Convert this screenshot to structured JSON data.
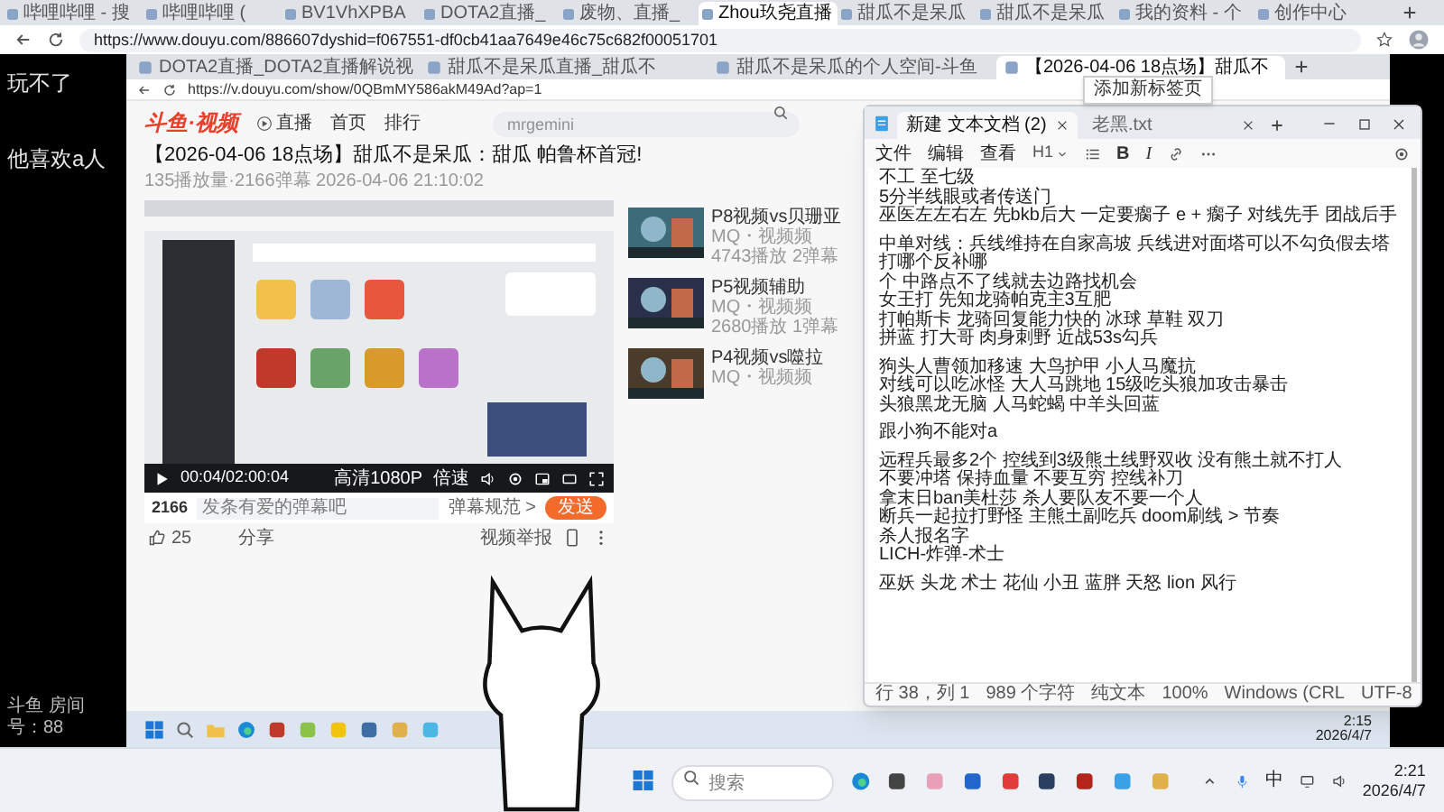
{
  "browser": {
    "tabs": [
      {
        "label": "哔哩哔哩 - 搜",
        "selected": false
      },
      {
        "label": "哔哩哔哩 (",
        "selected": false
      },
      {
        "label": "BV1VhXPBA",
        "selected": false
      },
      {
        "label": "DOTA2直播_",
        "selected": false
      },
      {
        "label": "废物、直播_",
        "selected": false
      },
      {
        "label": "Zhou玖尧直播",
        "selected": true
      },
      {
        "label": "甜瓜不是呆瓜",
        "selected": false
      },
      {
        "label": "甜瓜不是呆瓜",
        "selected": false
      },
      {
        "label": "我的资料 - 个",
        "selected": false
      },
      {
        "label": "创作中心",
        "selected": false
      }
    ],
    "url": "https://www.douyu.com/886607dyshid=f067551-df0cb41aa7649e46c75c682f00051701"
  },
  "stream": {
    "comments": [
      "玩不了",
      "他喜欢a人"
    ],
    "room_label": "斗鱼 房间号：88"
  },
  "inner_browser": {
    "tabs": [
      {
        "label": "DOTA2直播_DOTA2直播解说视",
        "selected": false
      },
      {
        "label": "甜瓜不是呆瓜直播_甜瓜不",
        "selected": false
      },
      {
        "label": "甜瓜不是呆瓜的个人空间-斗鱼",
        "selected": false
      },
      {
        "label": "【2026-04-06 18点场】甜瓜不",
        "selected": true
      }
    ],
    "url": "https://v.douyu.com/show/0QBmMY586akM49Ad?ap=1"
  },
  "site": {
    "logo": "斗鱼·视频",
    "live_link": "直播",
    "nav": [
      "首页",
      "排行"
    ],
    "search": {
      "placeholder": "mrgemini"
    }
  },
  "video": {
    "title": "【2026-04-06 18点场】甜瓜不是呆瓜：甜瓜 帕鲁杯首冠!",
    "meta": "135播放量·2166弹幕  2026-04-06 21:10:02",
    "time": "00:04/02:00:04",
    "quality": "高清1080P",
    "speed": "倍速"
  },
  "danmaku_bar": {
    "count": "2166",
    "placeholder": "发条有爱的弹幕吧",
    "rules": "弹幕规范 >",
    "send": "发送"
  },
  "actions": {
    "likes": "25",
    "share": "分享",
    "report": "视频举报"
  },
  "related": [
    {
      "title": "P8视频vs贝珊亚",
      "channel": "MQ・视频频",
      "stats": "4743播放 2弹幕"
    },
    {
      "title": "P5视频辅助",
      "channel": "MQ・视频频",
      "stats": "2680播放 1弹幕"
    },
    {
      "title": "P4视频vs噬拉",
      "channel": "MQ・视频频"
    }
  ],
  "notepad": {
    "tooltip": "添加新标签页",
    "tabs": [
      {
        "label": "新建 文本文档 (2)",
        "selected": true
      },
      {
        "label": "老黑.txt",
        "selected": false
      }
    ],
    "menu": [
      "文件",
      "编辑",
      "查看"
    ],
    "heading_style": "H1",
    "format_buttons": [
      "B",
      "I"
    ],
    "paragraphs": [
      [
        "不工 至七级",
        "5分半线眼或者传送门",
        "巫医左左右左 先bkb后大 一定要瘸子 e + 瘸子 对线先手 团战后手"
      ],
      [
        "中单对线：兵线维持在自家高坡 兵线进对面塔可以不勾负假去塔打哪个反补哪",
        "个 中路点不了线就去边路找机会",
        "女王打 先知龙骑帕克主3互肥",
        "打帕斯卡 龙骑回复能力快的 冰球 草鞋 双刀",
        "拼蓝 打大哥 肉身刺野 近战53s勾兵"
      ],
      [
        "狗头人曹领加移速 大鸟护甲 小人马魔抗",
        "对线可以吃冰怪 大人马跳地 15级吃头狼加攻击暴击",
        "头狼黑龙无脑 人马蛇蝎 中羊头回蓝"
      ],
      [
        "跟小狗不能对a"
      ],
      [
        "远程兵最多2个 控线到3级熊土线野双收 没有熊土就不打人",
        "不要冲塔 保持血量 不要互穷 控线补刀",
        "拿末日ban美杜莎 杀人要队友不要一个人",
        "断兵一起拉打野怪 主熊土副吃兵 doom刷线 > 节奏",
        "杀人报名字",
        "LICH-炸弹-术士"
      ],
      [
        "巫妖 头龙 术士 花仙 小丑 蓝胖 天怒 lion 风行"
      ]
    ],
    "status": [
      "行 38，列 1",
      "989 个字符",
      "纯文本",
      "100%",
      "Windows (CRL",
      "UTF-8"
    ]
  },
  "inner_taskbar": {
    "time": "2:15",
    "date": "2026/4/7"
  },
  "taskbar": {
    "search_placeholder": "搜索",
    "ime": "中",
    "time": "2:21",
    "date": "2026/4/7"
  }
}
